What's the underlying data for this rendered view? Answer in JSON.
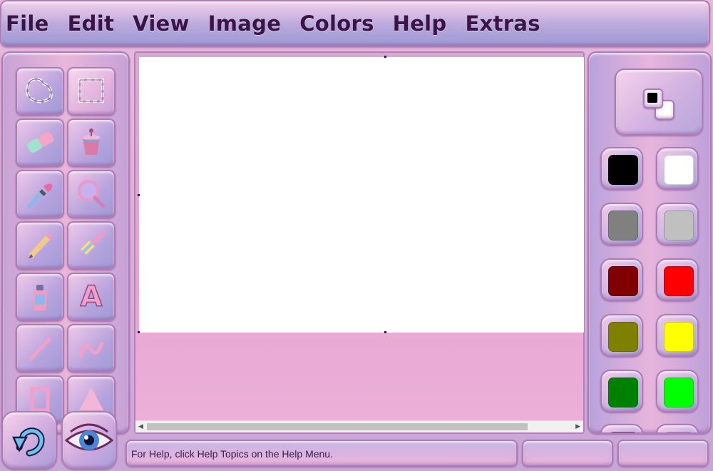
{
  "menu": [
    "File",
    "Edit",
    "View",
    "Image",
    "Colors",
    "Help",
    "Extras"
  ],
  "tools": [
    {
      "name": "free-form-select-tool",
      "icon": "lasso-icon"
    },
    {
      "name": "rect-select-tool",
      "icon": "rect-select-icon",
      "selected": true
    },
    {
      "name": "eraser-tool",
      "icon": "eraser-icon"
    },
    {
      "name": "fill-tool",
      "icon": "paint-bucket-icon"
    },
    {
      "name": "color-picker-tool",
      "icon": "eyedropper-icon"
    },
    {
      "name": "magnifier-tool",
      "icon": "magnifier-icon"
    },
    {
      "name": "pencil-tool",
      "icon": "pencil-icon"
    },
    {
      "name": "brush-tool",
      "icon": "brush-icon"
    },
    {
      "name": "airbrush-tool",
      "icon": "spray-can-icon"
    },
    {
      "name": "text-tool",
      "icon": "text-a-icon",
      "glyph": "A"
    },
    {
      "name": "line-tool",
      "icon": "line-icon"
    },
    {
      "name": "curve-tool",
      "icon": "curve-icon"
    },
    {
      "name": "rectangle-tool",
      "icon": "rectangle-icon"
    },
    {
      "name": "polygon-tool",
      "icon": "polygon-icon"
    }
  ],
  "palette": {
    "primary": "#000000",
    "secondary": "#ffffff",
    "colors": [
      "#000000",
      "#ffffff",
      "#808080",
      "#c0c0c0",
      "#800000",
      "#ff0000",
      "#808000",
      "#ffff00",
      "#008000",
      "#00ff00",
      "#008080",
      "#00ffff"
    ]
  },
  "buttons": {
    "undo_icon": "undo-arrow-icon",
    "view_icon": "eye-icon"
  },
  "status": {
    "help_text": "For Help, click Help Topics on the Help Menu.",
    "cell2": "",
    "cell3": ""
  }
}
